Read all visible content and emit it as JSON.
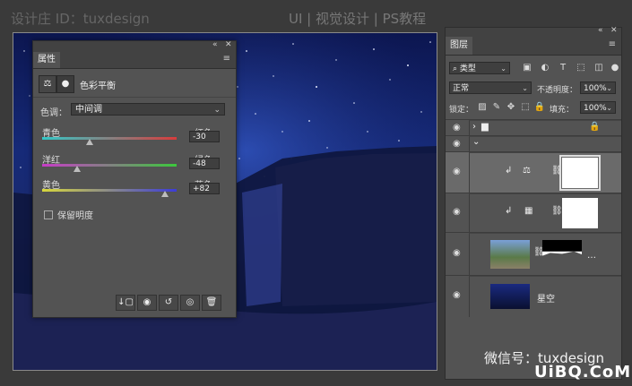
{
  "top_watermark": {
    "left": "设计庄 ID：tuxdesign",
    "right": "UI | 视觉设计 | PS教程"
  },
  "properties": {
    "tab": "属性",
    "adjustment_title": "色彩平衡",
    "tone_label": "色调：",
    "tone_value": "中间调",
    "sliders": [
      {
        "left": "青色",
        "right": "红色",
        "value": "-30",
        "position": 0.35,
        "gradient": [
          "#33c8c8",
          "#d83c3c"
        ]
      },
      {
        "left": "洋红",
        "right": "绿色",
        "value": "-48",
        "position": 0.26,
        "gradient": [
          "#c83cc8",
          "#3cc83c"
        ]
      },
      {
        "left": "黄色",
        "right": "蓝色",
        "value": "+82",
        "position": 0.91,
        "gradient": [
          "#d8d83c",
          "#3c3cd8"
        ]
      }
    ],
    "preserve_label": "保留明度"
  },
  "layers": {
    "tab": "图层",
    "filter_label": "类型",
    "blend_mode": "正常",
    "opacity_label": "不透明度：",
    "opacity_value": "100%",
    "lock_label": "锁定：",
    "fill_label": "填充：",
    "fill_value": "100%",
    "starry_layer_name": "星空"
  },
  "watermark_bottom": {
    "wechat": "微信号：tuxdesign",
    "uibq": "UiBQ.CoM"
  },
  "colors": {
    "panel_bg": "#535353",
    "panel_header": "#424242",
    "canvas_sky": "#162a78"
  }
}
